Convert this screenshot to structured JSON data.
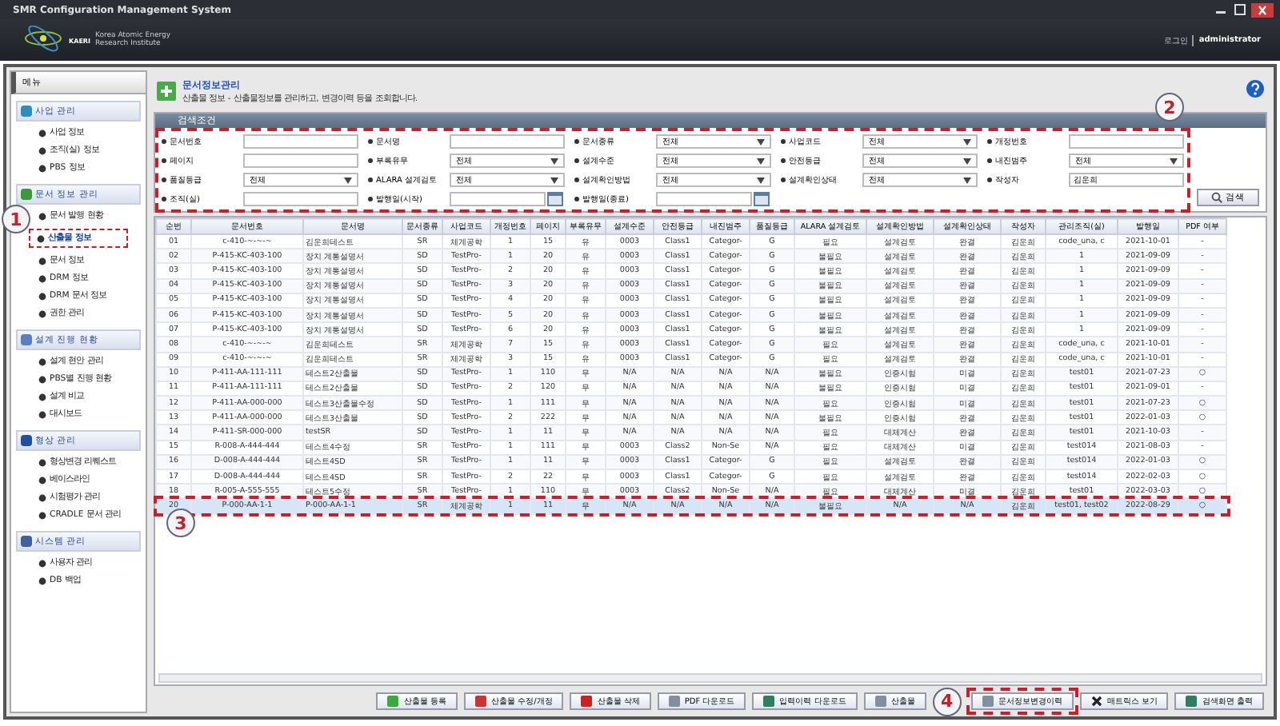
{
  "window": {
    "title": "SMR Configuration Management System"
  },
  "header": {
    "logo_text": "KAERI",
    "org_name": [
      "Korea Atomic Energy",
      "Research Institute"
    ],
    "login_label": "로그인",
    "user": "administrator"
  },
  "sidebar": {
    "title": "메뉴",
    "sections": [
      {
        "title": "사업 관리",
        "items": [
          {
            "label": "사업 정보",
            "selected": false
          },
          {
            "label": "조직(실) 정보",
            "selected": false
          },
          {
            "label": "PBS 정보",
            "selected": false
          }
        ]
      },
      {
        "title": "문서 정보 관리",
        "items": [
          {
            "label": "문서 발행 현황",
            "selected": false
          },
          {
            "label": "산출물 정보",
            "selected": true
          },
          {
            "label": "문서 정보",
            "selected": false
          },
          {
            "label": "DRM 정보",
            "selected": false
          },
          {
            "label": "DRM 문서 정보",
            "selected": false
          },
          {
            "label": "권한 관리",
            "selected": false
          }
        ]
      },
      {
        "title": "설계 진행 현황",
        "items": [
          {
            "label": "설계 현안 관리",
            "selected": false
          },
          {
            "label": "PBS별 진행 현황",
            "selected": false
          },
          {
            "label": "설계 비교",
            "selected": false
          },
          {
            "label": "대시보드",
            "selected": false
          }
        ]
      },
      {
        "title": "형상 관리",
        "items": [
          {
            "label": "형상변경 리퀘스트",
            "selected": false
          },
          {
            "label": "베이스라인",
            "selected": false
          },
          {
            "label": "시험평가 관리",
            "selected": false
          },
          {
            "label": "CRADLE 문서 관리",
            "selected": false
          }
        ]
      },
      {
        "title": "시스템 관리",
        "items": [
          {
            "label": "사용자 관리",
            "selected": false
          },
          {
            "label": "DB 백업",
            "selected": false
          }
        ]
      }
    ]
  },
  "page": {
    "title": "문서정보관리",
    "description": "산출물 정보 - 산출물정보를 관리하고, 변경이력 등을 조회합니다."
  },
  "filters": {
    "title": "검색조건",
    "fields": [
      {
        "label": "문서번호",
        "kind": "text"
      },
      {
        "label": "문서명",
        "kind": "text"
      },
      {
        "label": "문서종류",
        "kind": "select",
        "value": "전체"
      },
      {
        "label": "사업코드",
        "kind": "select",
        "value": "전체"
      },
      {
        "label": "개정번호",
        "kind": "text"
      },
      {
        "label": "페이지",
        "kind": "text"
      },
      {
        "label": "부록유무",
        "kind": "select",
        "value": "전체"
      },
      {
        "label": "설계수준",
        "kind": "select",
        "value": "전체"
      },
      {
        "label": "안전등급",
        "kind": "select",
        "value": "전체"
      },
      {
        "label": "내진범주",
        "kind": "select",
        "value": "전체"
      },
      {
        "label": "품질등급",
        "kind": "select",
        "value": "전체"
      },
      {
        "label": "ALARA 설계검토",
        "kind": "select",
        "value": "전체"
      },
      {
        "label": "설계확인방법",
        "kind": "select",
        "value": "전체"
      },
      {
        "label": "설계확인상태",
        "kind": "select",
        "value": "전체"
      },
      {
        "label": "작성자",
        "kind": "text",
        "value": "김운희"
      },
      {
        "label": "조직(실)",
        "kind": "text"
      },
      {
        "label": "발행일(시작)",
        "kind": "date"
      },
      {
        "label": "발행일(종료)",
        "kind": "date"
      }
    ],
    "search_button": "검색"
  },
  "table": {
    "columns": [
      "순번",
      "문서번호",
      "문서명",
      "문서종류",
      "사업코드",
      "개정번호",
      "페이지",
      "부록유무",
      "설계수준",
      "안전등급",
      "내진범주",
      "품질등급",
      "ALARA 설계검토",
      "설계확인방법",
      "설계확인상태",
      "작성자",
      "관리조직(실)",
      "발행일",
      "PDF 여부"
    ],
    "rows": [
      {
        "selected": false,
        "cells": [
          "01",
          "c-410-~-~-~",
          "김운희테스트",
          "SR",
          "체계공학",
          "1",
          "15",
          "유",
          "0003",
          "Class1",
          "Categor-",
          "G",
          "필요",
          "설계검토",
          "완결",
          "김운희",
          "code_una, c",
          "2021-10-01",
          "-"
        ]
      },
      {
        "selected": false,
        "cells": [
          "02",
          "P-415-KC-403-100",
          "장치 계통설명서",
          "SD",
          "TestPro-",
          "1",
          "20",
          "유",
          "0003",
          "Class1",
          "Categor-",
          "G",
          "불필요",
          "설계검토",
          "완결",
          "김운희",
          "1",
          "2021-09-09",
          "-"
        ]
      },
      {
        "selected": false,
        "cells": [
          "03",
          "P-415-KC-403-100",
          "장치 계통설명서",
          "SD",
          "TestPro-",
          "2",
          "20",
          "유",
          "0003",
          "Class1",
          "Categor-",
          "G",
          "불필요",
          "설계검토",
          "완결",
          "김운희",
          "1",
          "2021-09-09",
          "-"
        ]
      },
      {
        "selected": false,
        "cells": [
          "04",
          "P-415-KC-403-100",
          "장치 계통설명서",
          "SD",
          "TestPro-",
          "3",
          "20",
          "유",
          "0003",
          "Class1",
          "Categor-",
          "G",
          "불필요",
          "설계검토",
          "완결",
          "김운희",
          "1",
          "2021-09-09",
          "-"
        ]
      },
      {
        "selected": false,
        "cells": [
          "05",
          "P-415-KC-403-100",
          "장치 계통설명서",
          "SD",
          "TestPro-",
          "4",
          "20",
          "유",
          "0003",
          "Class1",
          "Categor-",
          "G",
          "불필요",
          "설계검토",
          "완결",
          "김운희",
          "1",
          "2021-09-09",
          "-"
        ]
      },
      {
        "selected": false,
        "cells": [
          "06",
          "P-415-KC-403-100",
          "장치 계통설명서",
          "SD",
          "TestPro-",
          "5",
          "20",
          "유",
          "0003",
          "Class1",
          "Categor-",
          "G",
          "불필요",
          "설계검토",
          "완결",
          "김운희",
          "1",
          "2021-09-09",
          "-"
        ]
      },
      {
        "selected": false,
        "cells": [
          "07",
          "P-415-KC-403-100",
          "장치 계통설명서",
          "SD",
          "TestPro-",
          "6",
          "20",
          "유",
          "0003",
          "Class1",
          "Categor-",
          "G",
          "불필요",
          "설계검토",
          "완결",
          "김운희",
          "1",
          "2021-09-09",
          "-"
        ]
      },
      {
        "selected": false,
        "cells": [
          "08",
          "c-410-~-~-~",
          "김운희테스트",
          "SR",
          "체계공학",
          "7",
          "15",
          "유",
          "0003",
          "Class1",
          "Categor-",
          "G",
          "필요",
          "설계검토",
          "완결",
          "김운희",
          "code_una, c",
          "2021-10-01",
          "-"
        ]
      },
      {
        "selected": false,
        "cells": [
          "09",
          "c-410-~-~-~",
          "김운희테스트",
          "SR",
          "체계공학",
          "3",
          "15",
          "유",
          "0003",
          "Class1",
          "Categor-",
          "G",
          "필요",
          "설계검토",
          "완결",
          "김운희",
          "code_una, c",
          "2021-10-01",
          "-"
        ]
      },
      {
        "selected": false,
        "cells": [
          "10",
          "P-411-AA-111-111",
          "테스트2산출물",
          "SD",
          "TestPro-",
          "1",
          "110",
          "무",
          "N/A",
          "N/A",
          "N/A",
          "N/A",
          "불필요",
          "인증시험",
          "미결",
          "김운희",
          "test01",
          "2021-07-23",
          "○"
        ]
      },
      {
        "selected": false,
        "cells": [
          "11",
          "P-411-AA-111-111",
          "테스트2산출물",
          "SD",
          "TestPro-",
          "2",
          "120",
          "무",
          "N/A",
          "N/A",
          "N/A",
          "N/A",
          "불필요",
          "인증시험",
          "미결",
          "김운희",
          "test01",
          "2021-09-01",
          "-"
        ]
      },
      {
        "selected": false,
        "cells": [
          "12",
          "P-411-AA-000-000",
          "테스트3산출물수정",
          "SD",
          "TestPro-",
          "1",
          "111",
          "무",
          "N/A",
          "N/A",
          "N/A",
          "N/A",
          "필요",
          "인증시험",
          "미결",
          "김운희",
          "test01",
          "2021-07-23",
          "○"
        ]
      },
      {
        "selected": false,
        "cells": [
          "13",
          "P-411-AA-000-000",
          "테스트3산출물",
          "SD",
          "TestPro-",
          "2",
          "222",
          "무",
          "N/A",
          "N/A",
          "N/A",
          "N/A",
          "불필요",
          "인증시험",
          "완결",
          "김운희",
          "test01",
          "2022-01-03",
          "○"
        ]
      },
      {
        "selected": false,
        "cells": [
          "14",
          "P-411-SR-000-000",
          "testSR",
          "SD",
          "TestPro-",
          "1",
          "11",
          "무",
          "N/A",
          "N/A",
          "N/A",
          "N/A",
          "필요",
          "대체계산",
          "완결",
          "김운희",
          "test01",
          "2021-10-03",
          "-"
        ]
      },
      {
        "selected": false,
        "cells": [
          "15",
          "R-008-A-444-444",
          "테스트4수정",
          "SR",
          "TestPro-",
          "1",
          "111",
          "무",
          "0003",
          "Class2",
          "Non-Se",
          "N/A",
          "필요",
          "대체계산",
          "미결",
          "김운희",
          "test014",
          "2021-08-03",
          "-"
        ]
      },
      {
        "selected": false,
        "cells": [
          "16",
          "D-008-A-444-444",
          "테스트4SD",
          "SR",
          "TestPro-",
          "1",
          "11",
          "무",
          "0003",
          "Class1",
          "Categor-",
          "G",
          "필요",
          "설계검토",
          "완결",
          "김운희",
          "test014",
          "2022-01-03",
          "○"
        ]
      },
      {
        "selected": false,
        "cells": [
          "17",
          "D-008-A-444-444",
          "테스트4SD",
          "SR",
          "TestPro-",
          "2",
          "22",
          "무",
          "0003",
          "Class1",
          "Categor-",
          "G",
          "필요",
          "설계검토",
          "완결",
          "김운희",
          "test014",
          "2022-02-03",
          "○"
        ]
      },
      {
        "selected": false,
        "cells": [
          "18",
          "R-005-A-555-555",
          "테스트5수정",
          "SR",
          "TestPro-",
          "1",
          "110",
          "무",
          "0003",
          "Class2",
          "Non-Se",
          "N/A",
          "필요",
          "대체계산",
          "미결",
          "김운희",
          "test01",
          "2022-03-03",
          "○"
        ]
      },
      {
        "selected": true,
        "cells": [
          "20",
          "P-000-AA-1-1",
          "P-000-AA-1-1",
          "SR",
          "체계공학",
          "1",
          "11",
          "무",
          "N/A",
          "N/A",
          "N/A",
          "N/A",
          "불필요",
          "N/A",
          "N/A",
          "김운희",
          "test01, test02",
          "2022-08-29",
          "○"
        ]
      }
    ]
  },
  "buttons": [
    {
      "label": "산출물 등록"
    },
    {
      "label": "산출물 수정/개정"
    },
    {
      "label": "산출물 삭제"
    },
    {
      "label": "PDF 다운로드"
    },
    {
      "label": "입력이력 다운로드"
    },
    {
      "label": "산출물"
    },
    {
      "label": "문서정보변경이력"
    },
    {
      "label": "매트릭스 보기"
    },
    {
      "label": "검색화면 출력"
    }
  ],
  "callouts": [
    {
      "number": "1"
    },
    {
      "number": "2"
    },
    {
      "number": "3"
    },
    {
      "number": "4"
    }
  ]
}
